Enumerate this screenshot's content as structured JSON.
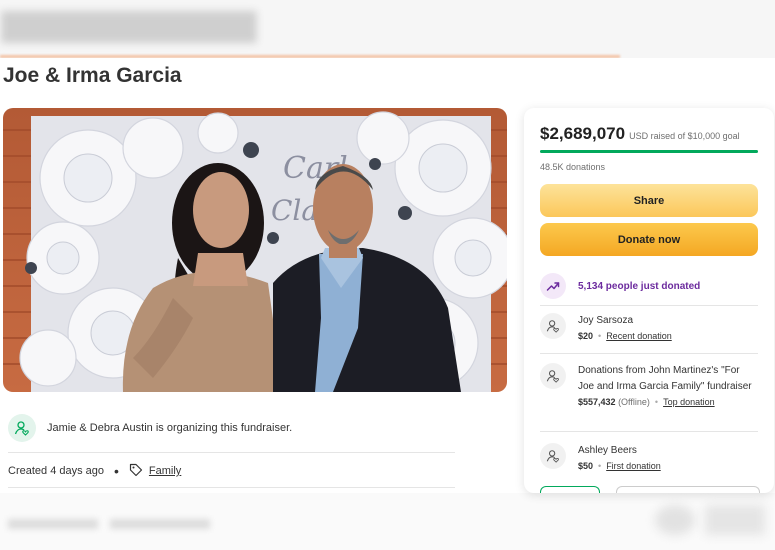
{
  "campaign": {
    "title": "Joe & Irma Garcia",
    "organizer_text": "Jamie & Debra Austin is organizing this fundraiser.",
    "created": "Created 4 days ago",
    "category": "Family"
  },
  "donation_card": {
    "amount_raised": "$2,689,070",
    "goal_text": "USD raised of $10,000 goal",
    "progress_fraction": 1.0,
    "donation_count": "48.5K donations",
    "share_label": "Share",
    "donate_label": "Donate now",
    "trending_text": "5,134 people just donated",
    "donors": [
      {
        "name": "Joy Sarsoza",
        "amount": "$20",
        "tag": "Recent donation"
      },
      {
        "name": "Donations from John Martinez's \"For Joe and Irma Garcia Family\" fundraiser",
        "amount": "$557,432",
        "note": "(Offline)",
        "tag": "Top donation"
      },
      {
        "name": "Ashley Beers",
        "amount": "$50",
        "tag": "First donation"
      }
    ]
  },
  "colors": {
    "accent_green": "#02a95c",
    "donate_orange": "#f4a723",
    "share_yellow": "#fbc75a",
    "trend_purple": "#6c2b9e"
  },
  "icons": [
    "organizer-heart-icon",
    "tag-icon",
    "trending-up-icon",
    "donor-heart-icon"
  ]
}
